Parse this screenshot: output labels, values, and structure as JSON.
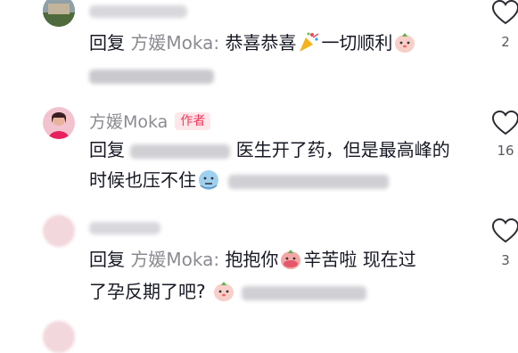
{
  "comments": [
    {
      "reply_word": "回复",
      "reply_to": "方媛Moka:",
      "text_a": "恭喜恭喜",
      "text_b": "一切顺利",
      "like_count": "2",
      "emojis": [
        "party-popper",
        "hamster-happy"
      ]
    },
    {
      "username": "方媛Moka",
      "badge": "作者",
      "reply_word": "回复",
      "text_a": "医生开了药，但是最高峰的",
      "text_b": "时候也压不住",
      "like_count": "16",
      "emojis": [
        "sweat-face"
      ]
    },
    {
      "reply_word": "回复",
      "reply_to": "方媛Moka:",
      "text_a": "抱抱你",
      "text_b": "辛苦啦 现在过",
      "text_c": "了孕反期了吧?",
      "like_count": "3",
      "emojis": [
        "hamster-hug",
        "hamster-happy"
      ]
    }
  ],
  "colors": {
    "accent": "#f0395a",
    "muted": "#8a8b91",
    "text": "#161823"
  }
}
